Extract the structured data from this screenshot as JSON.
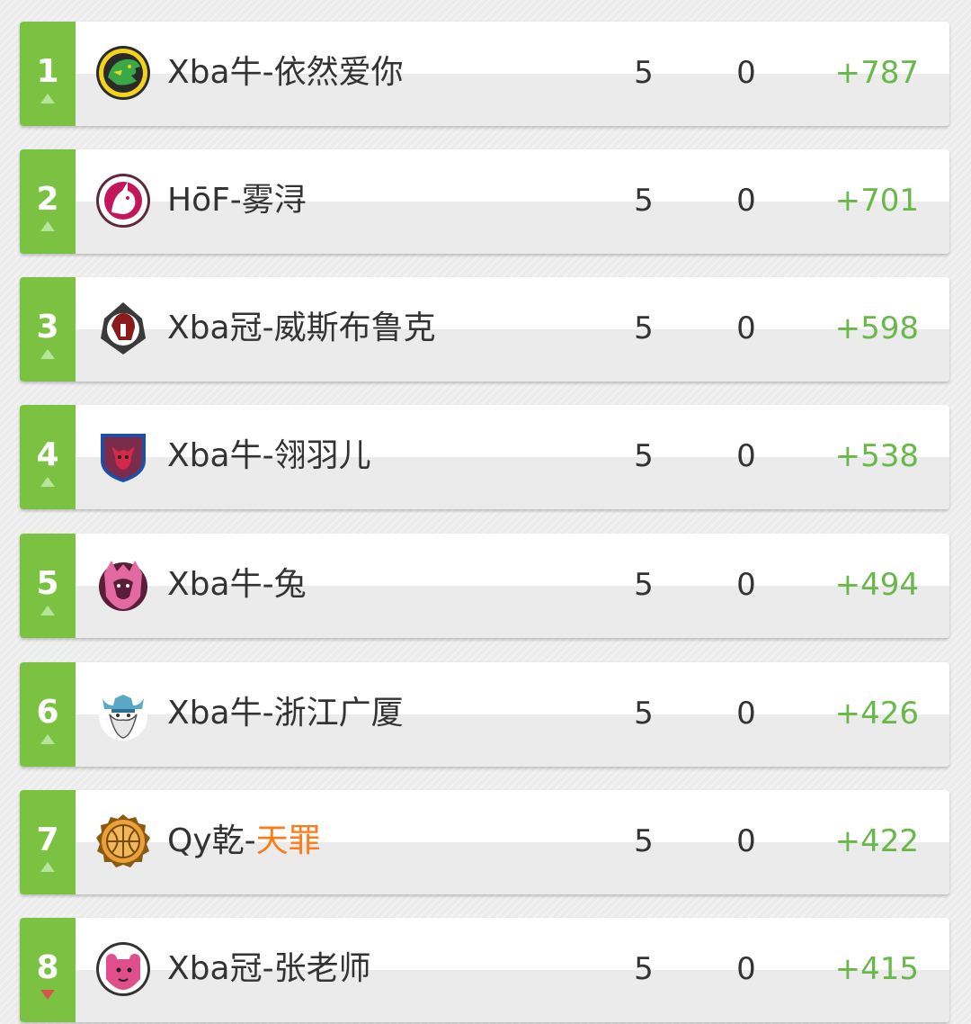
{
  "rows": [
    {
      "rank": "1",
      "trend": "up",
      "team_prefix": "Xba牛-依然爱你",
      "team_highlight": "",
      "wins": "5",
      "losses": "0",
      "diff": "+787",
      "logo": "green-dragon-badge"
    },
    {
      "rank": "2",
      "trend": "up",
      "team_prefix": "HōF-雾浔",
      "team_highlight": "",
      "wins": "5",
      "losses": "0",
      "diff": "+701",
      "logo": "pink-unicorn-badge"
    },
    {
      "rank": "3",
      "trend": "up",
      "team_prefix": "Xba冠-威斯布鲁克",
      "team_highlight": "",
      "wins": "5",
      "losses": "0",
      "diff": "+598",
      "logo": "red-spartan-badge"
    },
    {
      "rank": "4",
      "trend": "up",
      "team_prefix": "Xba牛-翎羽儿",
      "team_highlight": "",
      "wins": "5",
      "losses": "0",
      "diff": "+538",
      "logo": "red-bull-shield"
    },
    {
      "rank": "5",
      "trend": "up",
      "team_prefix": "Xba牛-兔",
      "team_highlight": "",
      "wins": "5",
      "losses": "0",
      "diff": "+494",
      "logo": "pink-beast-badge"
    },
    {
      "rank": "6",
      "trend": "up",
      "team_prefix": "Xba牛-浙江广厦",
      "team_highlight": "",
      "wins": "5",
      "losses": "0",
      "diff": "+426",
      "logo": "viking-badge"
    },
    {
      "rank": "7",
      "trend": "up",
      "team_prefix": "Qy乾-",
      "team_highlight": "天罪",
      "wins": "5",
      "losses": "0",
      "diff": "+422",
      "logo": "basketball-badge"
    },
    {
      "rank": "8",
      "trend": "down",
      "team_prefix": "Xba冠-张老师",
      "team_highlight": "",
      "wins": "5",
      "losses": "0",
      "diff": "+415",
      "logo": "pink-bear-badge"
    }
  ],
  "colors": {
    "rank_green": "#7cc242",
    "diff_green": "#69b84a",
    "highlight_orange": "#ff7a1a",
    "trend_up": "#b6e49a",
    "trend_down": "#d9534f"
  }
}
